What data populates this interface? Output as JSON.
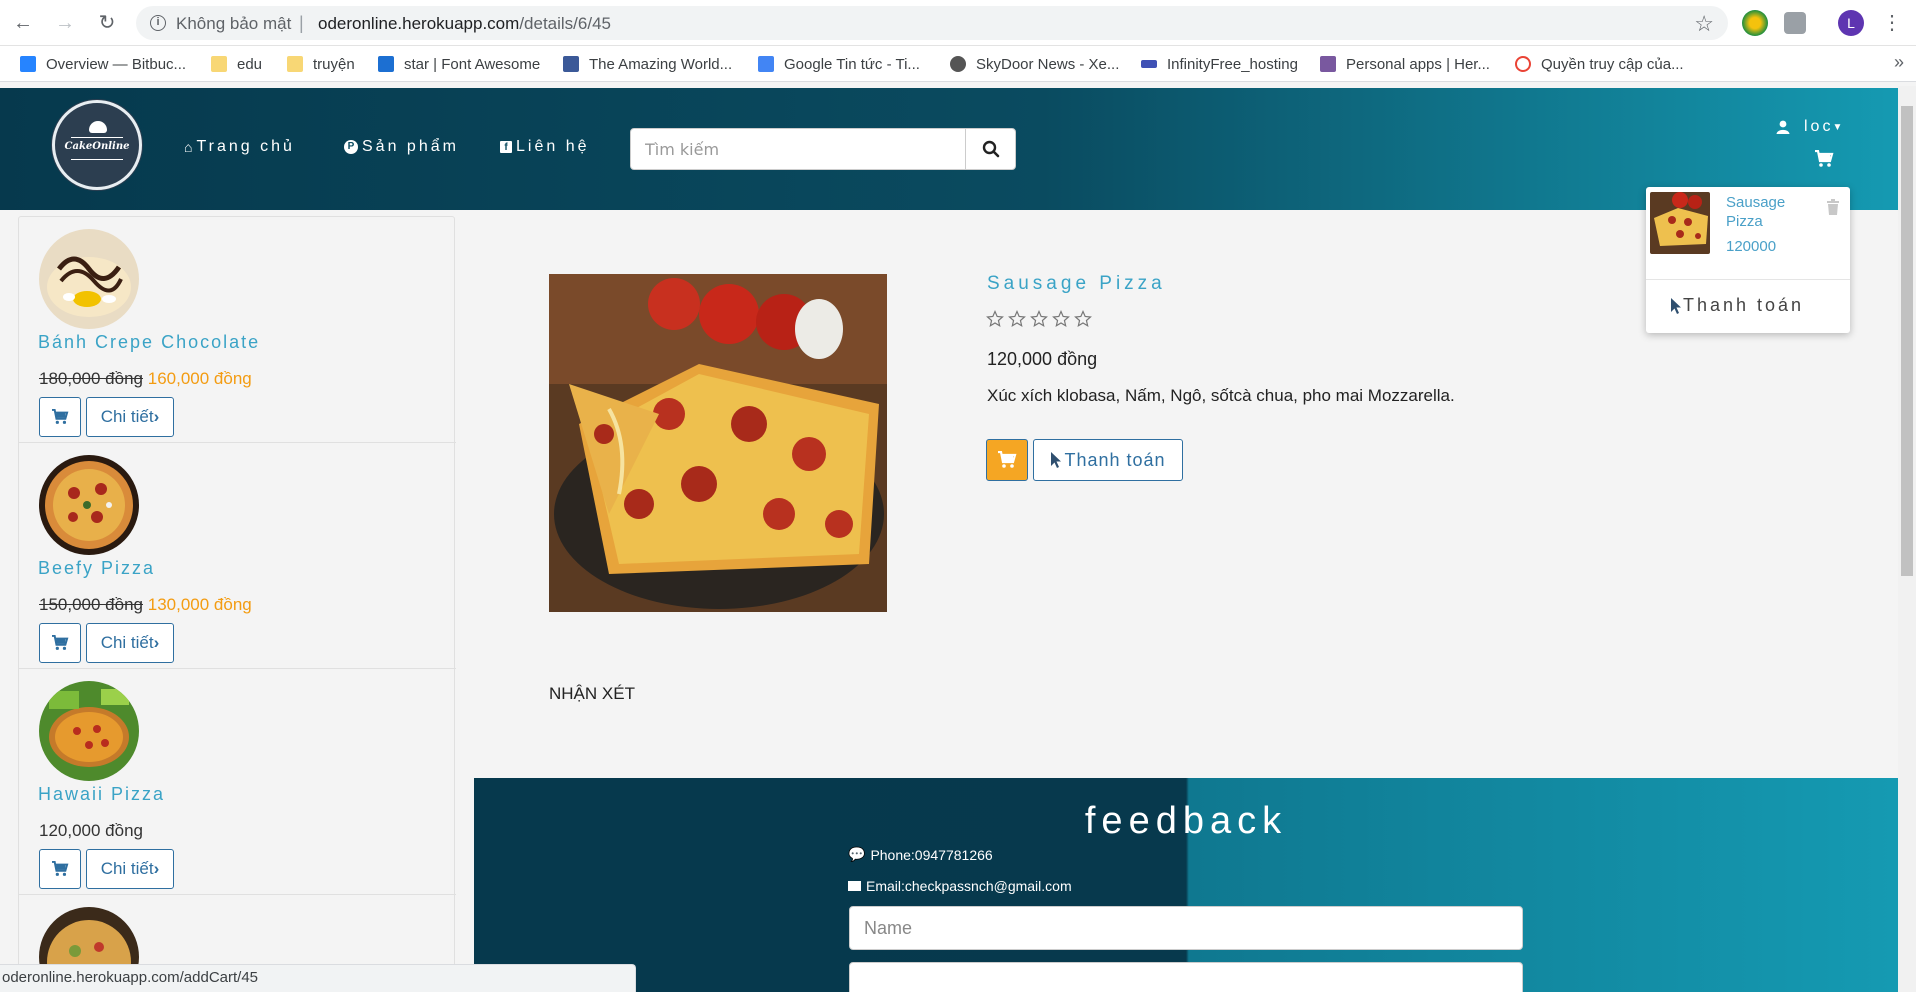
{
  "browser": {
    "security_label": "Không bảo mật",
    "url_host": "oderonline.herokuapp.com",
    "url_path": "/details/6/45",
    "avatar_letter": "L",
    "status_url": "oderonline.herokuapp.com/addCart/45"
  },
  "bookmarks": [
    {
      "label": "Overview — Bitbuc...",
      "color": "#2684ff"
    },
    {
      "label": "edu",
      "color": "#f8d775"
    },
    {
      "label": "truyện",
      "color": "#f8d775"
    },
    {
      "label": "star | Font Awesome",
      "color": "#1c6fd2"
    },
    {
      "label": "The Amazing World...",
      "color": "#3b5998"
    },
    {
      "label": "Google Tin tức - Ti...",
      "color": "#4285f4"
    },
    {
      "label": "SkyDoor News - Xe...",
      "color": "#555555"
    },
    {
      "label": "InfinityFree_hosting",
      "color": "#3f51b5"
    },
    {
      "label": "Personal apps | Her...",
      "color": "#79589f"
    },
    {
      "label": "Quyền truy cập của...",
      "color": "#ea4335"
    }
  ],
  "header": {
    "logo_text": "CakeOnline",
    "nav": [
      {
        "label": "Trang chủ",
        "icon": "home-icon"
      },
      {
        "label": "Sản phẩm",
        "icon": "product-hunt-icon"
      },
      {
        "label": "Liên hệ",
        "icon": "facebook-icon"
      }
    ],
    "search_placeholder": "Tìm kiếm",
    "user": "loc"
  },
  "cart_dropdown": {
    "item_name": "Sausage Pizza",
    "item_price": "120000",
    "checkout_label": "Thanh toán"
  },
  "sidebar": {
    "items": [
      {
        "title": "Bánh Crepe Chocolate",
        "old_price": "180,000 đồng",
        "new_price": "160,000 đồng",
        "detail_label": "Chi tiết"
      },
      {
        "title": "Beefy Pizza",
        "old_price": "150,000 đồng",
        "new_price": "130,000 đồng",
        "detail_label": "Chi tiết"
      },
      {
        "title": "Hawaii Pizza",
        "old_price": "",
        "new_price": "",
        "price": "120,000 đồng",
        "detail_label": "Chi tiết"
      }
    ]
  },
  "product": {
    "title": "Sausage Pizza",
    "rating": 0,
    "rating_max": 5,
    "price": "120,000 đồng",
    "description": "Xúc xích klobasa, Nấm, Ngô, sốtcà chua, pho mai Mozzarella.",
    "checkout_label": "Thanh toán",
    "reviews_heading": "NHẬN XÉT"
  },
  "feedback": {
    "title": "feedback",
    "phone": "Phone:0947781266",
    "email": "Email:checkpassnch@gmail.com",
    "name_placeholder": "Name"
  },
  "colors": {
    "accent": "#3aa3c6",
    "sale": "#f39c12",
    "header_dark": "#06394d",
    "header_light": "#159ab2",
    "cart_button": "#f5a623"
  }
}
